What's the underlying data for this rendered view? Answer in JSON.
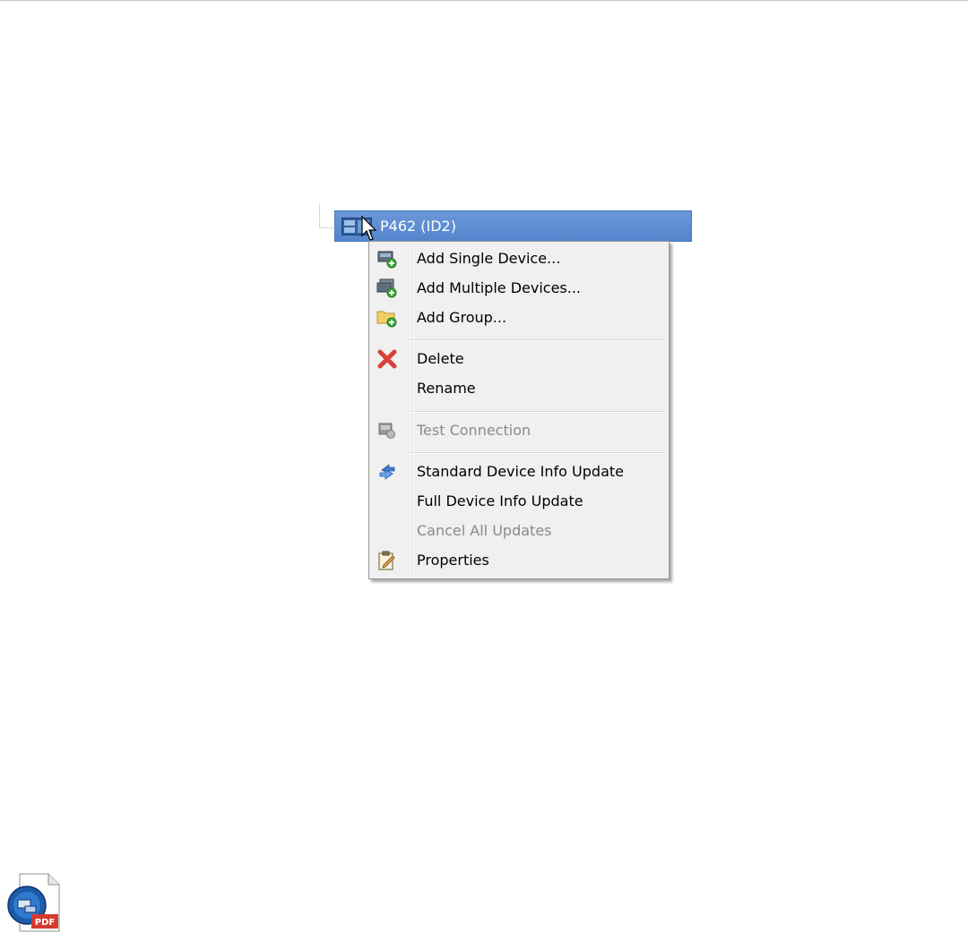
{
  "tree": {
    "node_label": "P462 (ID2)"
  },
  "context_menu": {
    "items": [
      {
        "label": "Add Single Device...",
        "icon": "add-device-icon",
        "enabled": true
      },
      {
        "label": "Add Multiple Devices...",
        "icon": "add-multiple-devices-icon",
        "enabled": true
      },
      {
        "label": "Add Group...",
        "icon": "add-group-folder-icon",
        "enabled": true
      },
      {
        "label": "Delete",
        "icon": "delete-x-icon",
        "enabled": true
      },
      {
        "label": "Rename",
        "icon": "",
        "enabled": true
      },
      {
        "label": "Test Connection",
        "icon": "test-connection-icon",
        "enabled": false
      },
      {
        "label": "Standard Device Info Update",
        "icon": "refresh-arrows-icon",
        "enabled": true
      },
      {
        "label": "Full Device Info Update",
        "icon": "",
        "enabled": true
      },
      {
        "label": "Cancel All Updates",
        "icon": "",
        "enabled": false
      },
      {
        "label": "Properties",
        "icon": "properties-clipboard-icon",
        "enabled": true
      }
    ]
  },
  "colors": {
    "selection": "#5c8dd3",
    "menu_bg": "#f0f0f0",
    "disabled_text": "#8a8a8a"
  },
  "footer_icon": {
    "badge": "PDF"
  }
}
